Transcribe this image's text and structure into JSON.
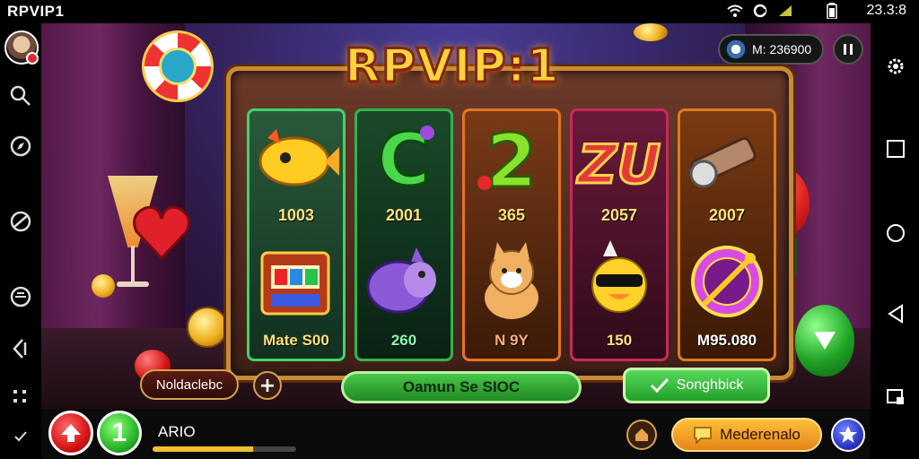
{
  "status_bar": {
    "app_name": "RPVIP1",
    "time": "23.3:8",
    "icons": [
      "wifi-icon",
      "sync-icon",
      "signal-icon",
      "battery-icon"
    ]
  },
  "left_rail": {
    "icons": [
      "avatar",
      "search-icon",
      "compass-icon",
      "globe-icon",
      "chat-icon",
      "back-arrow-icon",
      "grid-icon",
      "check-icon"
    ]
  },
  "right_rail": {
    "icons": [
      "settings-gear-icon",
      "recent-apps-icon",
      "home-circle-icon",
      "back-triangle-icon",
      "screenshot-icon"
    ]
  },
  "game": {
    "title": "RPVIP:1",
    "coin_balance": "M: 236900",
    "reels": [
      {
        "top_symbol": "golden-fish-icon",
        "top_value": "1003",
        "bottom_symbol": "slot-machine-icon",
        "bottom_value": "Mate S00",
        "border_color": "#3fd36a"
      },
      {
        "top_symbol": "letter-c-icon",
        "top_value": "2001",
        "bottom_symbol": "purple-creature-icon",
        "bottom_value": "260",
        "border_color": "#2fb54a"
      },
      {
        "top_symbol": "number-2-icon",
        "top_value": "365",
        "bottom_symbol": "shiba-dog-icon",
        "bottom_value": "N 9Y",
        "border_color": "#e4761e"
      },
      {
        "top_symbol": "letters-zu-icon",
        "top_value": "2057",
        "bottom_symbol": "cool-duck-icon",
        "bottom_value": "150",
        "border_color": "#c72a5a"
      },
      {
        "top_symbol": "cannon-icon",
        "top_value": "2007",
        "bottom_symbol": "compass-wheel-icon",
        "bottom_value": "M95.080",
        "border_color": "#e07b1a"
      }
    ],
    "left_button": "Noldaclebc",
    "plus_button": "+",
    "center_button": "Oamun Se SIOC",
    "right_button": "Songhbick"
  },
  "bottom_bar": {
    "label": "ARIO",
    "progress": 0.7,
    "green_button": "1",
    "pill_button": "Mederenalo"
  },
  "colors": {
    "title_gold": "#ffd23c",
    "accent_green": "#2fb54a",
    "accent_orange": "#e5851a",
    "accent_red": "#d41414"
  }
}
